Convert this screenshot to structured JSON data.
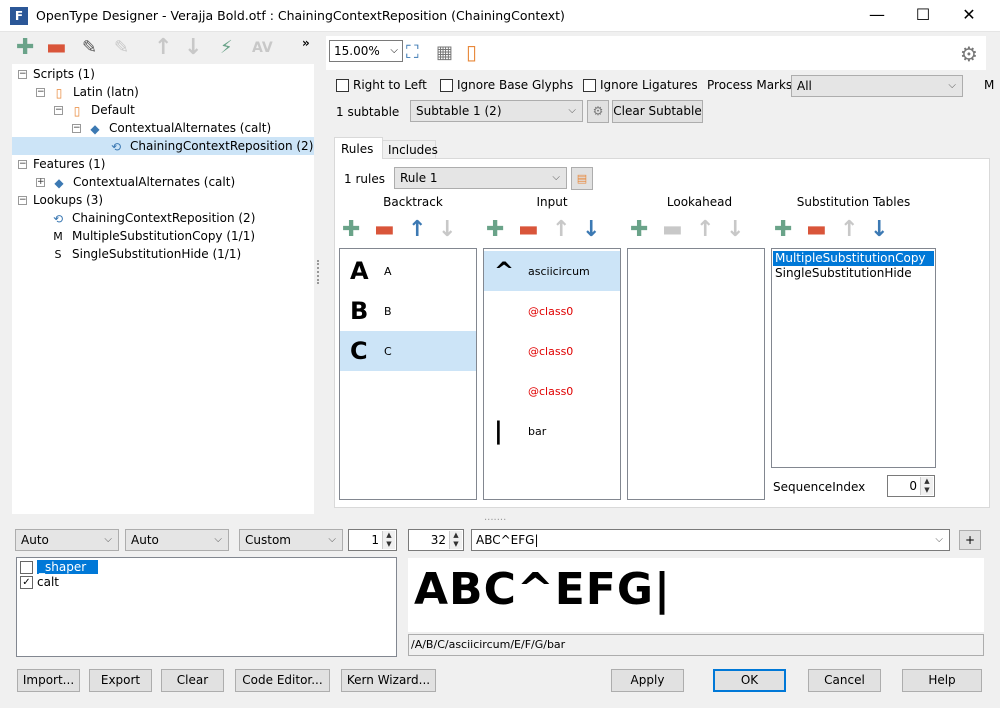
{
  "window": {
    "title": "OpenType Designer - Verajja Bold.otf : ChainingContextReposition (ChainingContext)",
    "app_icon": "F",
    "minimize": "—",
    "maximize": "☐",
    "close": "✕"
  },
  "tree": {
    "scripts": "Scripts (1)",
    "latin": "Latin (latn)",
    "default": "Default",
    "calt": "ContextualAlternates (calt)",
    "ccr": "ChainingContextReposition (2)",
    "features": "Features (1)",
    "feat_calt": "ContextualAlternates (calt)",
    "lookups": "Lookups (3)",
    "lk1": "ChainingContextReposition (2)",
    "lk2": "MultipleSubstitutionCopy (1/1)",
    "lk3": "SingleSubstitutionHide (1/1)"
  },
  "toolbar": {
    "more": "»",
    "zoom": "15.00%"
  },
  "options": {
    "rtl": "Right to Left",
    "ignore_base": "Ignore Base Glyphs",
    "ignore_lig": "Ignore Ligatures",
    "process_marks_label": "Process Marks:",
    "process_marks": "All",
    "cut_label": "M"
  },
  "subtable": {
    "count": "1 subtable",
    "selected": "Subtable 1 (2)",
    "clear": "Clear Subtable"
  },
  "tabs": [
    "Rules",
    "Includes"
  ],
  "rules": {
    "count": "1 rules",
    "selected": "Rule 1"
  },
  "columns": {
    "backtrack": "Backtrack",
    "input": "Input",
    "lookahead": "Lookahead",
    "subst": "Substitution Tables"
  },
  "backtrack": [
    {
      "glyph": "A",
      "name": "A"
    },
    {
      "glyph": "B",
      "name": "B"
    },
    {
      "glyph": "C",
      "name": "C"
    }
  ],
  "input": [
    {
      "glyph": "^",
      "name": "asciicircum"
    },
    {
      "glyph": "",
      "name": "@class0"
    },
    {
      "glyph": "",
      "name": "@class0"
    },
    {
      "glyph": "",
      "name": "@class0"
    },
    {
      "glyph": "|",
      "name": "bar"
    }
  ],
  "subst_tables": [
    "MultipleSubstitutionCopy",
    "SingleSubstitutionHide"
  ],
  "sequence_index": {
    "label": "SequenceIndex",
    "value": "0"
  },
  "splitter": ".......",
  "bottom": {
    "script_combo": "Auto",
    "lang_combo": "Auto",
    "mode_combo": "Custom",
    "spin1": "1",
    "size": "32",
    "text": "ABC^EFG|",
    "add": "+",
    "features": [
      {
        "name": "_shaper",
        "checked": false
      },
      {
        "name": "calt",
        "checked": true
      }
    ],
    "preview": "ABC^EFG|",
    "glyph_string": "/A/B/C/asciicircum/E/F/G/bar"
  },
  "buttons": {
    "import": "Import...",
    "export": "Export",
    "clear": "Clear",
    "code_editor": "Code Editor...",
    "kern_wizard": "Kern Wizard...",
    "apply": "Apply",
    "ok": "OK",
    "cancel": "Cancel",
    "help": "Help"
  }
}
